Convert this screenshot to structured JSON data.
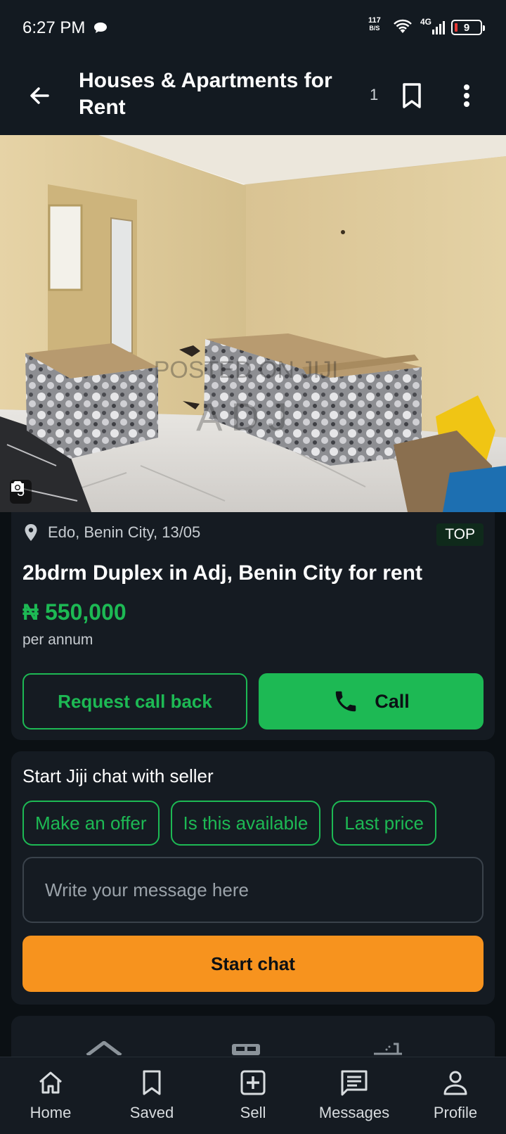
{
  "status_bar": {
    "time": "6:27 PM",
    "net_speed_value": "117",
    "net_speed_unit": "B/S",
    "network_type": "4G",
    "battery_level": "9"
  },
  "app_bar": {
    "title": "Houses & Apartments for Rent",
    "bookmark_count": "1"
  },
  "photo": {
    "image_count": "5",
    "watermark_line1": "POSTED ON JIJI",
    "watermark_line2": "ADJ"
  },
  "listing": {
    "location": "Edo, Benin City, 13/05",
    "badge": "TOP",
    "title": "2bdrm Duplex in Adj, Benin City for rent",
    "price": "₦ 550,000",
    "price_period": "per annum",
    "request_callback_label": "Request call back",
    "call_label": "Call"
  },
  "chat": {
    "heading": "Start Jiji chat with seller",
    "quick_replies": [
      "Make an offer",
      "Is this available",
      "Last price"
    ],
    "message_placeholder": "Write your message here",
    "start_chat_label": "Start chat"
  },
  "bottom_nav": {
    "items": [
      {
        "label": "Home",
        "icon": "home-icon"
      },
      {
        "label": "Saved",
        "icon": "bookmark-icon"
      },
      {
        "label": "Sell",
        "icon": "plus-square-icon"
      },
      {
        "label": "Messages",
        "icon": "message-icon"
      },
      {
        "label": "Profile",
        "icon": "person-icon"
      }
    ]
  },
  "colors": {
    "accent_green": "#1db954",
    "accent_orange": "#f7931e",
    "background": "#0b1014",
    "card": "#151b22"
  }
}
